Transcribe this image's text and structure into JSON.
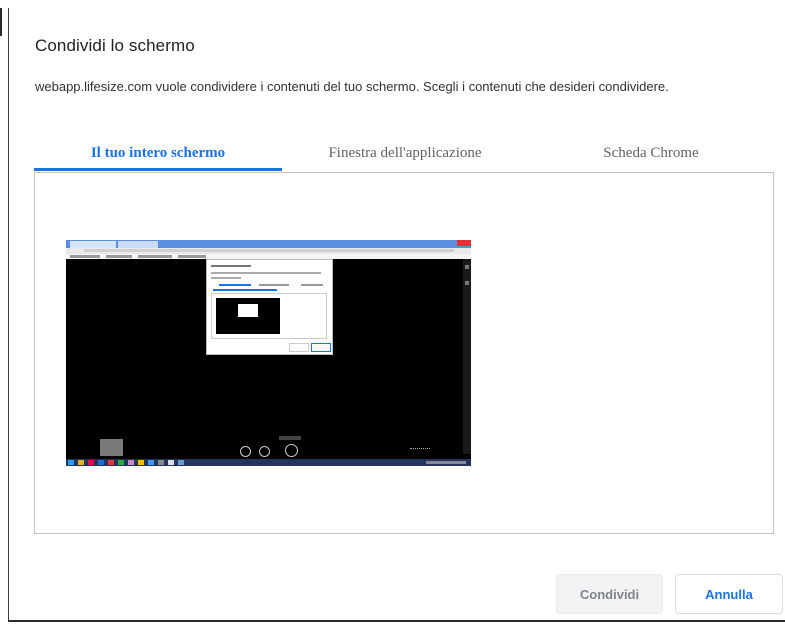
{
  "dialog": {
    "title": "Condividi lo schermo",
    "description": "webapp.lifesize.com vuole condividere i contenuti del tuo schermo. Scegli i contenuti che desideri condividere."
  },
  "tabs": [
    {
      "label": "Il tuo intero schermo",
      "active": true
    },
    {
      "label": "Finestra dell'applicazione",
      "active": false
    },
    {
      "label": "Scheda Chrome",
      "active": false
    }
  ],
  "preview": {
    "selected": false,
    "icon": "screen-thumbnail"
  },
  "buttons": {
    "share_label": "Condividi",
    "share_enabled": false,
    "cancel_label": "Annulla"
  },
  "colors": {
    "accent": "#1a73e8",
    "disabled_text": "#80868b",
    "disabled_bg": "#f1f3f4"
  }
}
